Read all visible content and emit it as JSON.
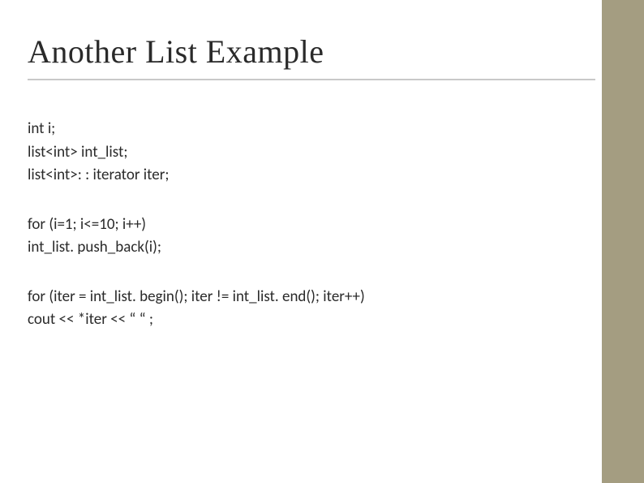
{
  "title": "Another List Example",
  "block1": {
    "line1": "int i;",
    "line2": "list<int> int_list;",
    "line3": "list<int>: : iterator iter;"
  },
  "block2": {
    "line1": "for (i=1; i<=10; i++)",
    "line2": "int_list. push_back(i);"
  },
  "block3": {
    "line1": "for (iter = int_list. begin(); iter != int_list. end(); iter++)",
    "line2": "cout << *iter << “ “ ;"
  }
}
